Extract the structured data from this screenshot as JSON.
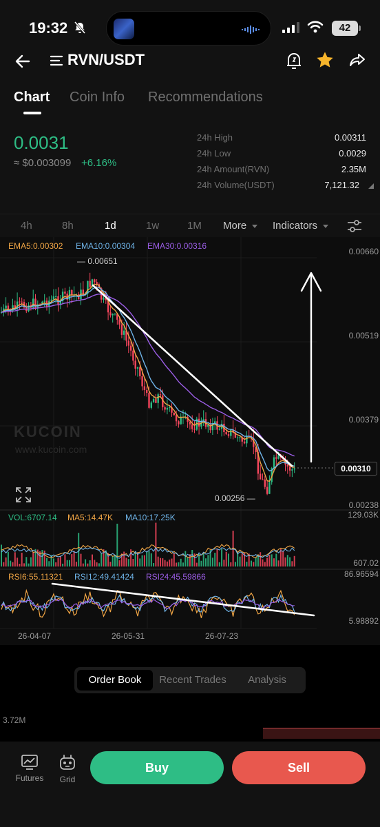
{
  "status_bar": {
    "time": "19:32",
    "battery": "42"
  },
  "header": {
    "pair": "RVN/USDT",
    "tabs": [
      {
        "label": "Chart",
        "active": true
      },
      {
        "label": "Coin Info",
        "active": false
      },
      {
        "label": "Recommendations",
        "active": false
      }
    ]
  },
  "ticker": {
    "price": "0.0031",
    "fiat_price": "≈ $0.003099",
    "change": "+6.16%",
    "stats": [
      {
        "label": "24h High",
        "value": "0.00311"
      },
      {
        "label": "24h Low",
        "value": "0.0029"
      },
      {
        "label": "24h Amount(RVN)",
        "value": "2.35M"
      },
      {
        "label": "24h Volume(USDT)",
        "value": "7,121.32"
      }
    ]
  },
  "timeframes": {
    "items": [
      "4h",
      "8h",
      "1d",
      "1w",
      "1M"
    ],
    "active": "1d",
    "more_label": "More",
    "indicators_label": "Indicators"
  },
  "chart": {
    "ema_legend": {
      "ema5": "EMA5:0.00302",
      "ema10": "EMA10:0.00304",
      "ema30": "EMA30:0.00316"
    },
    "price_axis": [
      "0.00660",
      "0.00519",
      "0.00379",
      "0.00238"
    ],
    "high_marker": "0.00651",
    "low_marker": "0.00256",
    "current_price": "0.00310",
    "watermark": "KUCOIN",
    "watermark_url": "www.kucoin.com",
    "vol_legend": {
      "vol": "VOL:6707.14",
      "ma5": "MA5:14.47K",
      "ma10": "MA10:17.25K"
    },
    "vol_axis": [
      "129.03K",
      "607.02"
    ],
    "rsi_legend": {
      "rsi6": "RSI6:55.11321",
      "rsi12": "RSI12:49.41424",
      "rsi24": "RSI24:45.59866"
    },
    "rsi_axis": [
      "86.96594",
      "5.98892"
    ],
    "x_labels": [
      "26-04-07",
      "26-05-31",
      "26-07-23"
    ],
    "colors": {
      "up": "#2ebd85",
      "down": "#f6465d",
      "ema5": "#f0a545",
      "ema10": "#6fb4e8",
      "ema30": "#9b5de5"
    }
  },
  "order_section": {
    "tabs": [
      "Order Book",
      "Recent Trades",
      "Analysis"
    ],
    "active": "Order Book",
    "depth_label": "3.72M"
  },
  "bottom_bar": {
    "futures_label": "Futures",
    "grid_label": "Grid",
    "buy_label": "Buy",
    "sell_label": "Sell"
  }
}
